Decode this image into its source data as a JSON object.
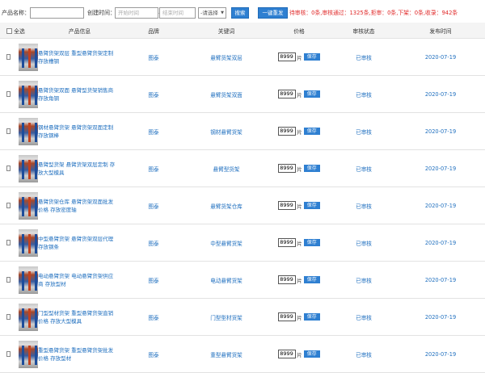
{
  "filter": {
    "name_label": "产品名称：",
    "time_label": "创建时间：",
    "start_placeholder": "开始时间",
    "dash": "—",
    "end_placeholder": "结束时间",
    "select_value": "-请选择",
    "search_btn": "搜索",
    "refresh_btn": "一键重发",
    "stats": "待审核：0条,审核通过：1325条,拒审：0条,下架：0条,收录：942条"
  },
  "table": {
    "headers": {
      "select_all": "全选",
      "product": "产品信息",
      "brand": "品牌",
      "keyword": "关键词",
      "price": "价格",
      "status": "审核状态",
      "date": "发布时间"
    },
    "rows": [
      {
        "title": "悬臂货架双层 重型悬臂货架定制 存放槽钢",
        "brand": "图泰",
        "keyword": "悬臂货架双层",
        "price": "8999",
        "unit": "片",
        "save": "保存",
        "status": "已审核",
        "date": "2020-07-19"
      },
      {
        "title": "悬臂货架双面 悬臂型货架销售商 存放角钢",
        "brand": "图泰",
        "keyword": "悬臂货架双面",
        "price": "8999",
        "unit": "片",
        "save": "保存",
        "status": "已审核",
        "date": "2020-07-19"
      },
      {
        "title": "钢材悬臂货架 悬臂货架双面定制 存放钢棒",
        "brand": "图泰",
        "keyword": "钢材悬臂货架",
        "price": "8999",
        "unit": "片",
        "save": "保存",
        "status": "已审核",
        "date": "2020-07-19"
      },
      {
        "title": "悬臂型货架 悬臂货架双层定制 存放大型模具",
        "brand": "图泰",
        "keyword": "悬臂型货架",
        "price": "8999",
        "unit": "片",
        "save": "保存",
        "status": "已审核",
        "date": "2020-07-19"
      },
      {
        "title": "悬臂货架仓库 悬臂货架双面批发价格 存放密度轴",
        "brand": "图泰",
        "keyword": "悬臂货架仓库",
        "price": "8999",
        "unit": "片",
        "save": "保存",
        "status": "已审核",
        "date": "2020-07-19"
      },
      {
        "title": "中型悬臂货架 悬臂货架双层代理 存放钢条",
        "brand": "图泰",
        "keyword": "中型悬臂货架",
        "price": "8999",
        "unit": "片",
        "save": "保存",
        "status": "已审核",
        "date": "2020-07-19"
      },
      {
        "title": "电动悬臂货架 电动悬臂货架供应商 存放型材",
        "brand": "图泰",
        "keyword": "电动悬臂货架",
        "price": "8999",
        "unit": "片",
        "save": "保存",
        "status": "已审核",
        "date": "2020-07-19"
      },
      {
        "title": "门型型材货架 重型悬臂货架直销价格 存放大型模具",
        "brand": "图泰",
        "keyword": "门型型材货架",
        "price": "8999",
        "unit": "片",
        "save": "保存",
        "status": "已审核",
        "date": "2020-07-19"
      },
      {
        "title": "重型悬臂货架 重型悬臂货架批发价格 存放型材",
        "brand": "图泰",
        "keyword": "重型悬臂货架",
        "price": "8999",
        "unit": "片",
        "save": "保存",
        "status": "已审核",
        "date": "2020-07-19"
      }
    ]
  }
}
